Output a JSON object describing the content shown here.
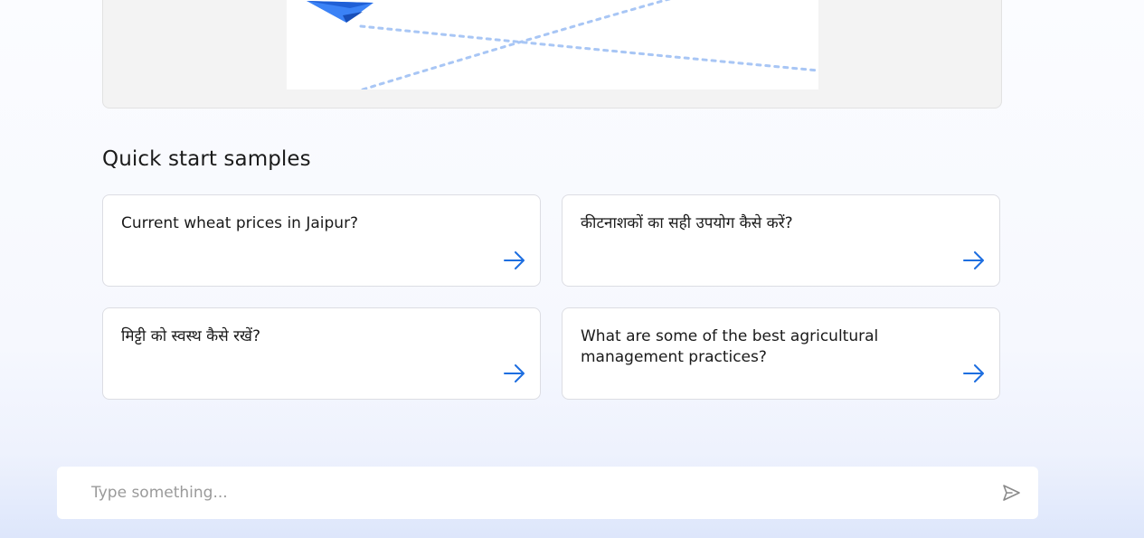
{
  "hero": {
    "illustration_icon": "paper-plane-icon",
    "accent_color": "#3b82f6",
    "trail_color": "#a8c6f5"
  },
  "samples": {
    "title": "Quick start samples",
    "arrow_icon": "arrow-right-icon",
    "accent_color": "#1d6ee0",
    "items": [
      {
        "text": "Current wheat prices in Jaipur?"
      },
      {
        "text": "कीटनाशकों का सही उपयोग कैसे करें?"
      },
      {
        "text": "मिट्टी को स्वस्थ कैसे रखें?"
      },
      {
        "text": "What are some of the best agricultural management practices?"
      }
    ]
  },
  "composer": {
    "placeholder": "Type something...",
    "value": "",
    "send_icon": "send-icon"
  }
}
